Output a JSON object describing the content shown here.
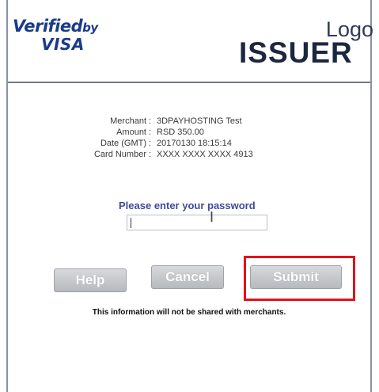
{
  "header": {
    "brand_line1": "Verified",
    "brand_by": "by",
    "brand_line2": "VISA",
    "issuer_logo_text": "Logo",
    "issuer_name": "ISSUER"
  },
  "transaction": {
    "rows": [
      {
        "label": "Merchant",
        "value": "3DPAYHOSTING Test"
      },
      {
        "label": "Amount",
        "value": "RSD 350.00"
      },
      {
        "label": "Date (GMT)",
        "value": "20170130 18:15:14"
      },
      {
        "label": "Card Number",
        "value": "XXXX XXXX XXXX 4913"
      }
    ]
  },
  "form": {
    "prompt": "Please enter your password",
    "password_value": ""
  },
  "buttons": {
    "help": "Help",
    "cancel": "Cancel",
    "submit": "Submit"
  },
  "notice": "This information will not be shared with merchants.",
  "colors": {
    "highlight": "#e3121b",
    "brand_blue": "#1a3a8a",
    "prompt_blue": "#3e4aa0"
  }
}
